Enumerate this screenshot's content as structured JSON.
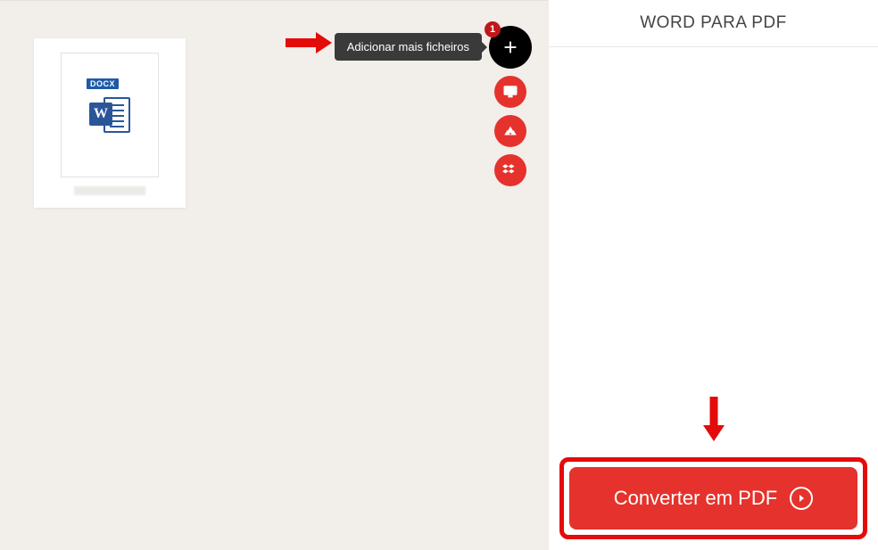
{
  "header": {
    "title": "WORD PARA PDF"
  },
  "file": {
    "type_badge": "DOCX",
    "letter": "W"
  },
  "add": {
    "tooltip": "Adicionar mais ficheiros",
    "badge_count": "1",
    "options": {
      "computer": "computer",
      "drive": "google-drive",
      "dropbox": "dropbox"
    }
  },
  "convert": {
    "label": "Converter em PDF"
  },
  "colors": {
    "accent": "#e5322d",
    "highlight": "#e40b0b"
  }
}
